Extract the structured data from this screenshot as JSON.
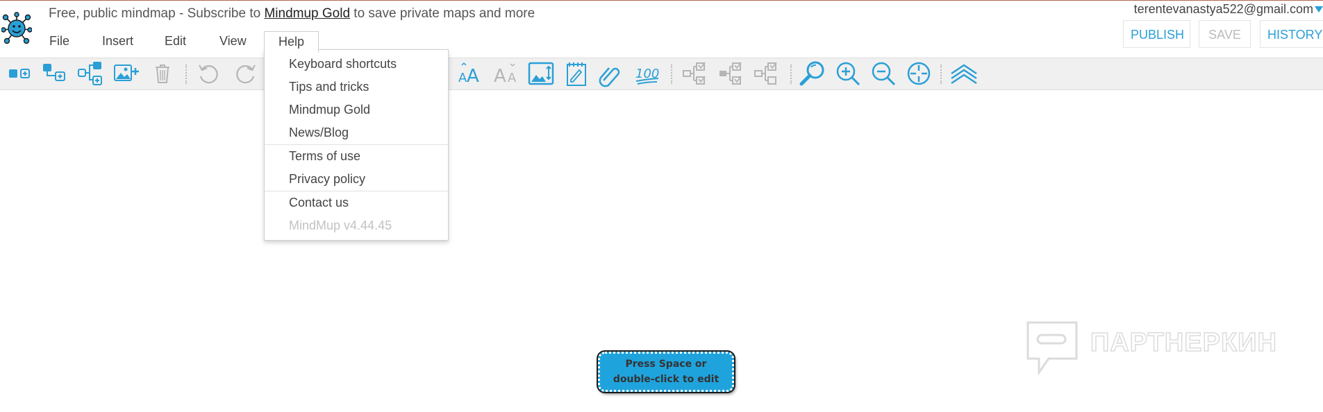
{
  "header": {
    "title_prefix": "Free, public mindmap - Subscribe to ",
    "title_link": "Mindmup Gold",
    "title_suffix": " to save private maps and more",
    "email": "terentevanastya522@gmail.com"
  },
  "menubar": {
    "file": "File",
    "insert": "Insert",
    "edit": "Edit",
    "view": "View",
    "help": "Help"
  },
  "buttons": {
    "publish": "PUBLISH",
    "save": "SAVE",
    "history": "HISTORY"
  },
  "help_menu": {
    "keyboard_shortcuts": "Keyboard shortcuts",
    "tips": "Tips and tricks",
    "gold": "Mindmup Gold",
    "news": "News/Blog",
    "terms": "Terms of use",
    "privacy": "Privacy policy",
    "contact": "Contact us",
    "version": "MindMup v4.44.45"
  },
  "canvas": {
    "node_text": "Press Space or double-click to edit",
    "watermark": "ПАРТНЕРКИН"
  },
  "colors": {
    "accent": "#2a9fd6",
    "node_fill": "#1fa3dc",
    "toolbar_bg": "#f0f0f0",
    "disabled_icon": "#b5b5b5"
  },
  "toolbar_icons": [
    "add-child-node-icon",
    "add-sibling-node-icon",
    "add-parent-node-icon",
    "add-image-icon",
    "delete-icon",
    "undo-icon",
    "redo-icon",
    "increase-font-icon",
    "decrease-font-icon",
    "resize-image-icon",
    "notes-icon",
    "link-icon",
    "progress-icon",
    "progress-1-icon",
    "progress-2-icon",
    "progress-3-icon",
    "search-icon",
    "zoom-in-icon",
    "zoom-out-icon",
    "center-icon",
    "collapse-icon"
  ]
}
